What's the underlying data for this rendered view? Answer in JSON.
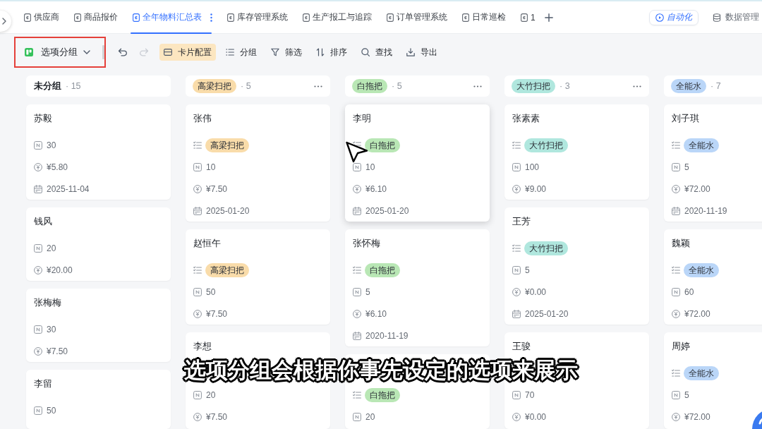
{
  "tab_bar": {
    "tabs": [
      {
        "label": "供应商",
        "selected": false
      },
      {
        "label": "商品报价",
        "selected": false
      },
      {
        "label": "全年物料汇总表",
        "selected": true
      },
      {
        "label": "库存管理系统",
        "selected": false
      },
      {
        "label": "生产报工与追踪",
        "selected": false
      },
      {
        "label": "订单管理系统",
        "selected": false
      },
      {
        "label": "日常巡检",
        "selected": false
      },
      {
        "label": "1",
        "selected": false
      }
    ],
    "automation": {
      "label": "自动化"
    },
    "data_manager": {
      "label": "数据管理"
    }
  },
  "toolbar": {
    "view_selector": {
      "label": "选项分组",
      "highlighted": true
    },
    "undo": {
      "disabled": false
    },
    "redo": {
      "disabled": true
    },
    "buttons": [
      {
        "kind": "card",
        "label": "卡片配置",
        "active": true
      },
      {
        "kind": "group",
        "label": "分组",
        "active": false
      },
      {
        "kind": "filter",
        "label": "筛选",
        "active": false
      },
      {
        "kind": "sort",
        "label": "排序",
        "active": false
      },
      {
        "kind": "search",
        "label": "查找",
        "active": false
      },
      {
        "kind": "export",
        "label": "导出",
        "active": false
      }
    ]
  },
  "board": {
    "columns": [
      {
        "kind": "plain",
        "title": "未分组",
        "count": "· 15",
        "more_button": false,
        "cards": [
          {
            "name": "苏毅",
            "hovered": false,
            "fields": [
              {
                "kind": "number",
                "value": "30"
              },
              {
                "kind": "currency",
                "value": "¥5.80"
              },
              {
                "kind": "date",
                "value": "2025-11-04"
              }
            ]
          },
          {
            "name": "钱风",
            "hovered": false,
            "fields": [
              {
                "kind": "number",
                "value": "20"
              },
              {
                "kind": "currency",
                "value": "¥20.00"
              }
            ]
          },
          {
            "name": "张梅梅",
            "hovered": false,
            "fields": [
              {
                "kind": "number",
                "value": "30"
              },
              {
                "kind": "currency",
                "value": "¥7.50"
              }
            ]
          },
          {
            "name": "李留",
            "hovered": false,
            "fields": [
              {
                "kind": "number",
                "value": "50"
              }
            ]
          }
        ]
      },
      {
        "kind": "tag",
        "title": "高梁扫把",
        "color": "#f9dcaa",
        "count": "· 5",
        "more_button": true,
        "cards": [
          {
            "name": "张伟",
            "hovered": false,
            "fields": [
              {
                "kind": "tag",
                "label": "高梁扫把",
                "color": "#f9dcaa"
              },
              {
                "kind": "number",
                "value": "10"
              },
              {
                "kind": "currency",
                "value": "¥7.50"
              },
              {
                "kind": "date",
                "value": "2025-01-20"
              }
            ]
          },
          {
            "name": "赵恒午",
            "hovered": false,
            "fields": [
              {
                "kind": "tag",
                "label": "高梁扫把",
                "color": "#f9dcaa"
              },
              {
                "kind": "number",
                "value": "50"
              },
              {
                "kind": "currency",
                "value": "¥7.50"
              }
            ]
          },
          {
            "name": "李想",
            "hovered": false,
            "fields": [
              {
                "kind": "covered"
              },
              {
                "kind": "number",
                "value": "20"
              },
              {
                "kind": "currency",
                "value": "¥7.50"
              }
            ]
          }
        ]
      },
      {
        "kind": "tag",
        "title": "白拖把",
        "color": "#b9e7b5",
        "count": "· 5",
        "more_button": true,
        "cards": [
          {
            "name": "李明",
            "hovered": true,
            "fields": [
              {
                "kind": "tag",
                "label": "白拖把",
                "color": "#b9e7b5"
              },
              {
                "kind": "number",
                "value": "10"
              },
              {
                "kind": "currency",
                "value": "¥6.10"
              },
              {
                "kind": "date",
                "value": "2025-01-20"
              }
            ]
          },
          {
            "name": "张怀梅",
            "hovered": false,
            "fields": [
              {
                "kind": "tag",
                "label": "白拖把",
                "color": "#b9e7b5"
              },
              {
                "kind": "number",
                "value": "5"
              },
              {
                "kind": "currency",
                "value": "¥6.10"
              },
              {
                "kind": "date",
                "value": "2020-11-19"
              }
            ]
          },
          {
            "hovered": false,
            "fields": [
              {
                "kind": "tag",
                "label": "白拖把",
                "color": "#b9e7b5"
              },
              {
                "kind": "number",
                "value": "20"
              }
            ]
          }
        ]
      },
      {
        "kind": "tag",
        "title": "大竹扫把",
        "color": "#b0e7de",
        "count": "· 3",
        "more_button": true,
        "cards": [
          {
            "name": "张素素",
            "hovered": false,
            "fields": [
              {
                "kind": "tag",
                "label": "大竹扫把",
                "color": "#b0e7de"
              },
              {
                "kind": "number",
                "value": "100"
              },
              {
                "kind": "currency",
                "value": "¥9.00"
              }
            ]
          },
          {
            "name": "王芳",
            "hovered": false,
            "fields": [
              {
                "kind": "tag",
                "label": "大竹扫把",
                "color": "#b0e7de"
              },
              {
                "kind": "number",
                "value": "5"
              },
              {
                "kind": "currency",
                "value": "¥0.00"
              },
              {
                "kind": "date",
                "value": "2025-01-20"
              }
            ]
          },
          {
            "name": "王骏",
            "hovered": false,
            "fields": [
              {
                "kind": "covered"
              },
              {
                "kind": "number",
                "value": "70"
              },
              {
                "kind": "currency",
                "value": "¥0.00"
              }
            ]
          }
        ]
      },
      {
        "kind": "tag",
        "title": "全能水",
        "color": "#bad6f8",
        "count": "· 7",
        "more_button": false,
        "cards": [
          {
            "name": "刘子琪",
            "hovered": false,
            "fields": [
              {
                "kind": "tag",
                "label": "全能水",
                "color": "#bad6f8"
              },
              {
                "kind": "number",
                "value": "5"
              },
              {
                "kind": "currency",
                "value": "¥72.00"
              },
              {
                "kind": "date",
                "value": "2020-11-19"
              }
            ]
          },
          {
            "name": "魏颖",
            "hovered": false,
            "fields": [
              {
                "kind": "tag",
                "label": "全能水",
                "color": "#bad6f8"
              },
              {
                "kind": "number",
                "value": "60"
              },
              {
                "kind": "currency",
                "value": "¥72.00"
              }
            ]
          },
          {
            "name": "周婷",
            "hovered": false,
            "fields": [
              {
                "kind": "tag",
                "label": "全能水",
                "color": "#bad6f8"
              },
              {
                "kind": "number",
                "value": "5"
              },
              {
                "kind": "currency",
                "value": "¥72.00"
              }
            ]
          }
        ]
      }
    ]
  },
  "caption": "选项分组会根据你事先设定的选项来展示"
}
